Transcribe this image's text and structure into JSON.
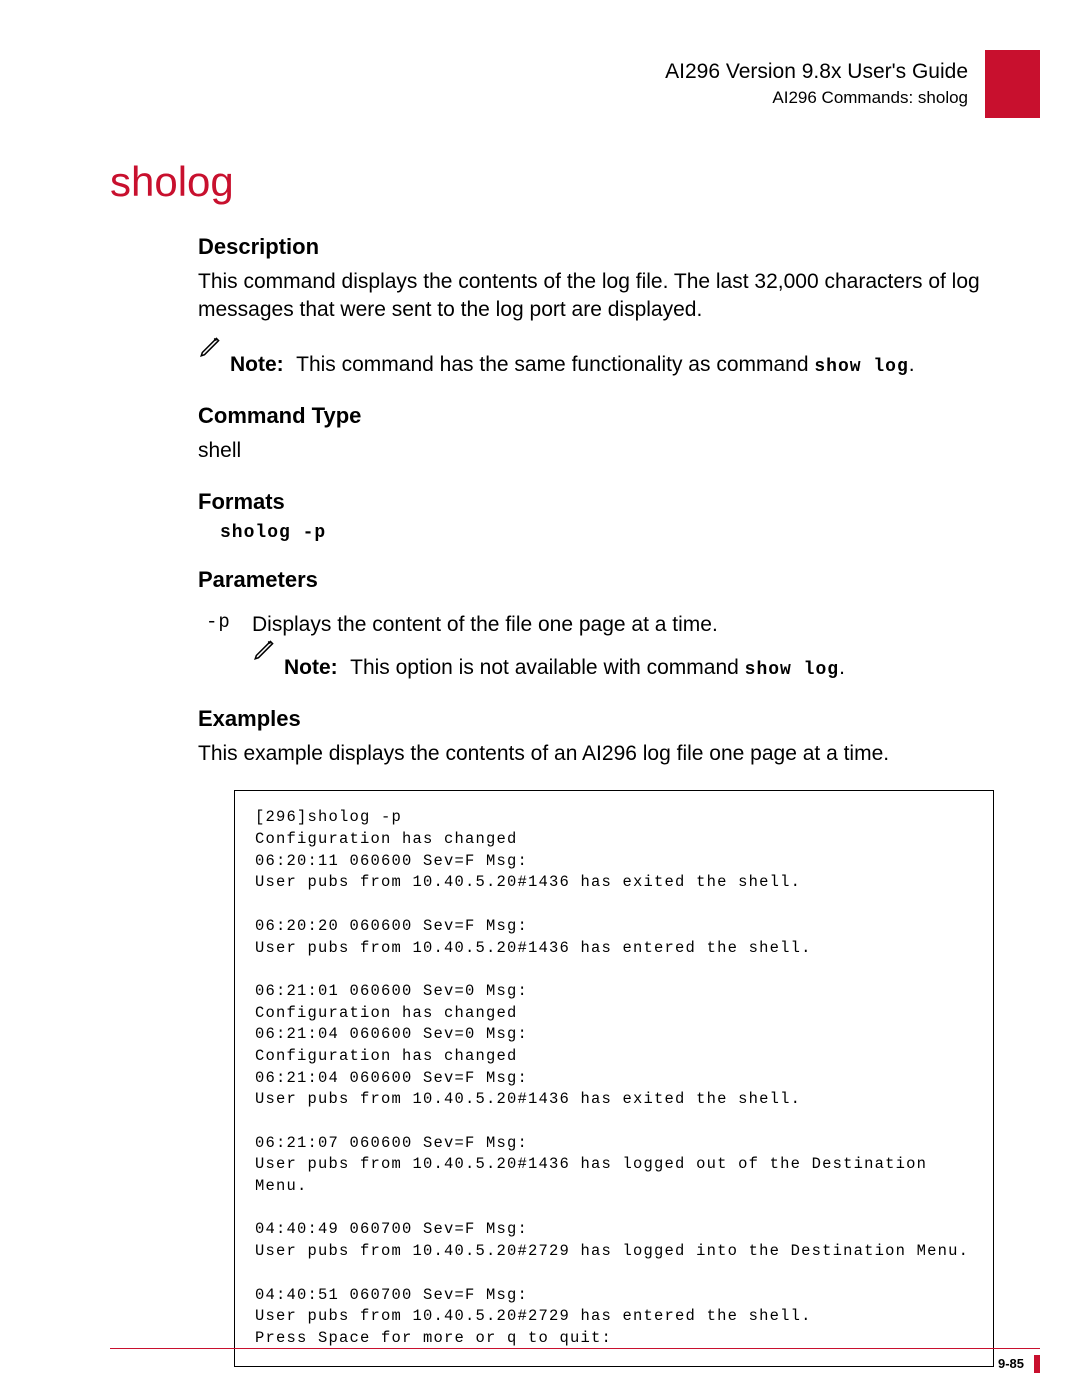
{
  "header": {
    "title": "AI296 Version 9.8x User's Guide",
    "subtitle": "AI296 Commands: sholog"
  },
  "command": {
    "name": "sholog"
  },
  "sections": {
    "description": {
      "heading": "Description",
      "text": "This command displays the contents of the log file. The last 32,000 characters of log messages that were sent to the log port are displayed.",
      "note_label": "Note:",
      "note_text": "This command has the same functionality as command ",
      "note_cmd": "show log",
      "note_tail": "."
    },
    "command_type": {
      "heading": "Command Type",
      "value": "shell"
    },
    "formats": {
      "heading": "Formats",
      "value": "sholog -p"
    },
    "parameters": {
      "heading": "Parameters",
      "flag": "-p",
      "desc": "Displays the content of the file one page at a time.",
      "note_label": "Note:",
      "note_text": "This option is not available with command ",
      "note_cmd": "show log",
      "note_tail": "."
    },
    "examples": {
      "heading": "Examples",
      "intro": "This example displays the contents of an AI296 log file one page at a time.",
      "output": "[296]sholog -p\nConfiguration has changed\n06:20:11 060600 Sev=F Msg:\nUser pubs from 10.40.5.20#1436 has exited the shell.\n\n06:20:20 060600 Sev=F Msg:\nUser pubs from 10.40.5.20#1436 has entered the shell.\n\n06:21:01 060600 Sev=0 Msg:\nConfiguration has changed\n06:21:04 060600 Sev=0 Msg:\nConfiguration has changed\n06:21:04 060600 Sev=F Msg:\nUser pubs from 10.40.5.20#1436 has exited the shell.\n\n06:21:07 060600 Sev=F Msg:\nUser pubs from 10.40.5.20#1436 has logged out of the Destination Menu.\n\n04:40:49 060700 Sev=F Msg:\nUser pubs from 10.40.5.20#2729 has logged into the Destination Menu.\n\n04:40:51 060700 Sev=F Msg:\nUser pubs from 10.40.5.20#2729 has entered the shell.\nPress Space for more or q to quit:"
    }
  },
  "footer": {
    "page": "9-85"
  }
}
